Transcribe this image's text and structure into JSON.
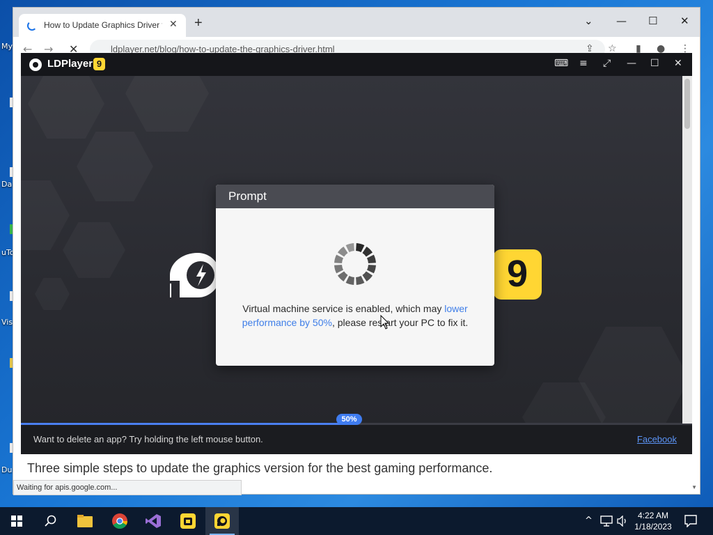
{
  "desktop": {
    "labels": [
      "My",
      "Da",
      "uTo",
      "Vis",
      "Du"
    ]
  },
  "chrome": {
    "tab_title": "How to Update Graphics Driver f",
    "tab_close": "✕",
    "new_tab": "+",
    "url": "ldplayer.net/blog/how-to-update-the-graphics-driver.html",
    "page_text": "Three simple steps to update the graphics version for the best gaming performance.",
    "status": "Waiting for apis.google.com...",
    "window_controls": {
      "dropdown": "⌄",
      "minimize": "—",
      "maximize": "☐",
      "close": "✕"
    },
    "nav": {
      "back": "←",
      "forward": "→",
      "reload": "✕"
    }
  },
  "ldplayer": {
    "name": "LDPlayer",
    "version_badge": "9",
    "big_badge": "9",
    "progress": {
      "label": "50%",
      "value": 0.5
    },
    "footer_tip": "Want to delete an app? Try holding the left mouse button.",
    "footer_link": "Facebook",
    "controls": {
      "gamepad": "🎮",
      "menu": "≡",
      "resize": "⤢",
      "minimize": "—",
      "maximize": "☐",
      "close": "✕"
    }
  },
  "prompt": {
    "title": "Prompt",
    "message_part1": "Virtual machine service is enabled, which may ",
    "message_link": "lower performance by 50%",
    "message_part2": ", please restart your PC to fix it."
  },
  "taskbar": {
    "apps": [
      "start",
      "search",
      "file-explorer",
      "chrome",
      "visual-studio",
      "ldplayer-multi",
      "ldplayer"
    ],
    "time": "4:22 AM",
    "date": "1/18/2023",
    "tray": {
      "chevron": "^",
      "network": "▭",
      "volume": "🔈"
    }
  },
  "colors": {
    "accent_blue": "#3f7cf0",
    "ld_yellow": "#ffd633",
    "ld_dark": "#15161a"
  }
}
